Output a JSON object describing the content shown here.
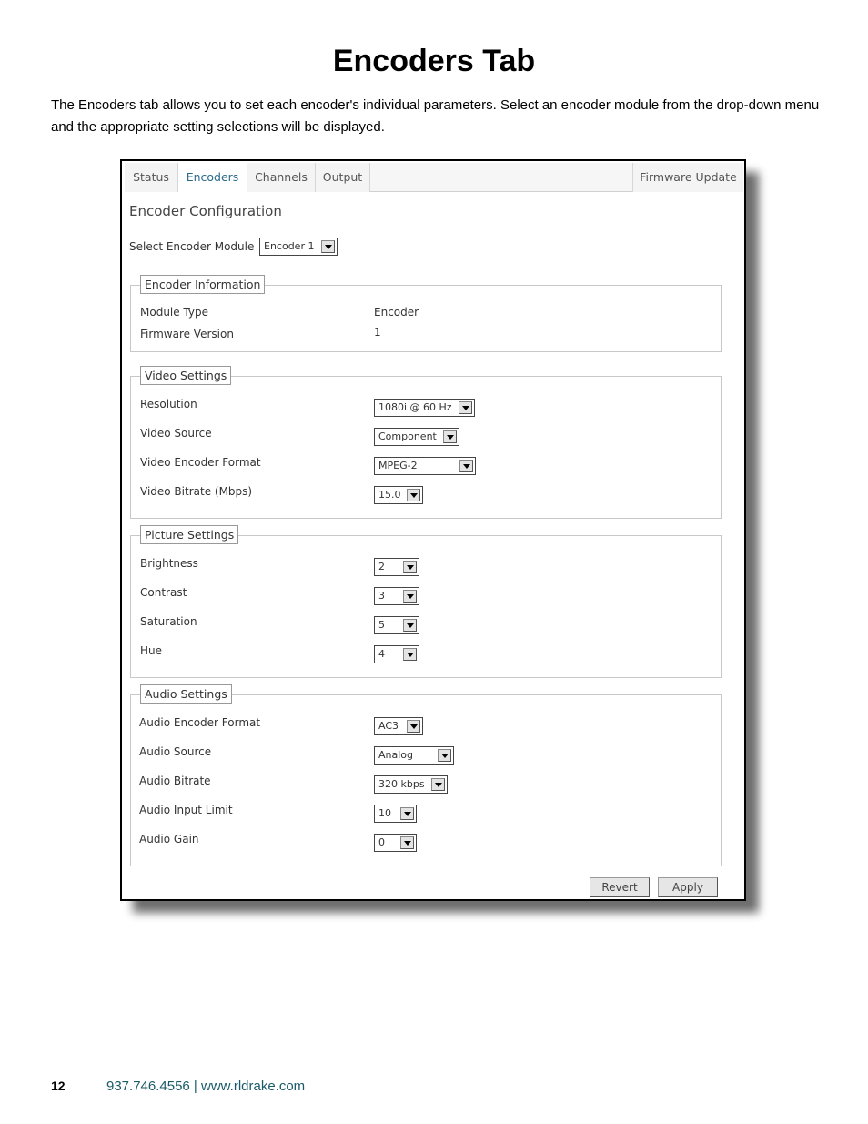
{
  "page": {
    "title": "Encoders Tab",
    "intro": "The Encoders tab allows you to set each encoder's individual parameters. Select an encoder module from the drop-down menu and the appropriate setting selections will be displayed.",
    "page_number": "12",
    "footer_contact": "937.746.4556 | www.rldrake.com"
  },
  "tabs": [
    {
      "label": "Status"
    },
    {
      "label": "Encoders"
    },
    {
      "label": "Channels"
    },
    {
      "label": "Output"
    },
    {
      "label": "Firmware Update"
    }
  ],
  "active_tab": "Encoders",
  "config": {
    "title": "Encoder Configuration",
    "select_module_label": "Select Encoder Module",
    "select_module_value": "Encoder 1"
  },
  "encoder_info": {
    "legend": "Encoder Information",
    "module_type_label": "Module Type",
    "module_type_value": "Encoder",
    "firmware_version_label": "Firmware Version",
    "firmware_version_value": "1"
  },
  "video": {
    "legend": "Video Settings",
    "resolution_label": "Resolution",
    "resolution_value": "1080i @ 60 Hz",
    "source_label": "Video Source",
    "source_value": "Component",
    "format_label": "Video Encoder Format",
    "format_value": "MPEG-2",
    "bitrate_label": "Video Bitrate (Mbps)",
    "bitrate_value": "15.0"
  },
  "picture": {
    "legend": "Picture Settings",
    "brightness_label": "Brightness",
    "brightness_value": "2",
    "contrast_label": "Contrast",
    "contrast_value": "3",
    "saturation_label": "Saturation",
    "saturation_value": "5",
    "hue_label": "Hue",
    "hue_value": "4"
  },
  "audio": {
    "legend": "Audio Settings",
    "format_label": "Audio Encoder Format",
    "format_value": "AC3",
    "source_label": "Audio Source",
    "source_value": "Analog",
    "bitrate_label": "Audio Bitrate",
    "bitrate_value": "320 kbps",
    "input_limit_label": "Audio Input Limit",
    "input_limit_value": "10",
    "gain_label": "Audio Gain",
    "gain_value": "0"
  },
  "buttons": {
    "revert": "Revert",
    "apply": "Apply"
  }
}
